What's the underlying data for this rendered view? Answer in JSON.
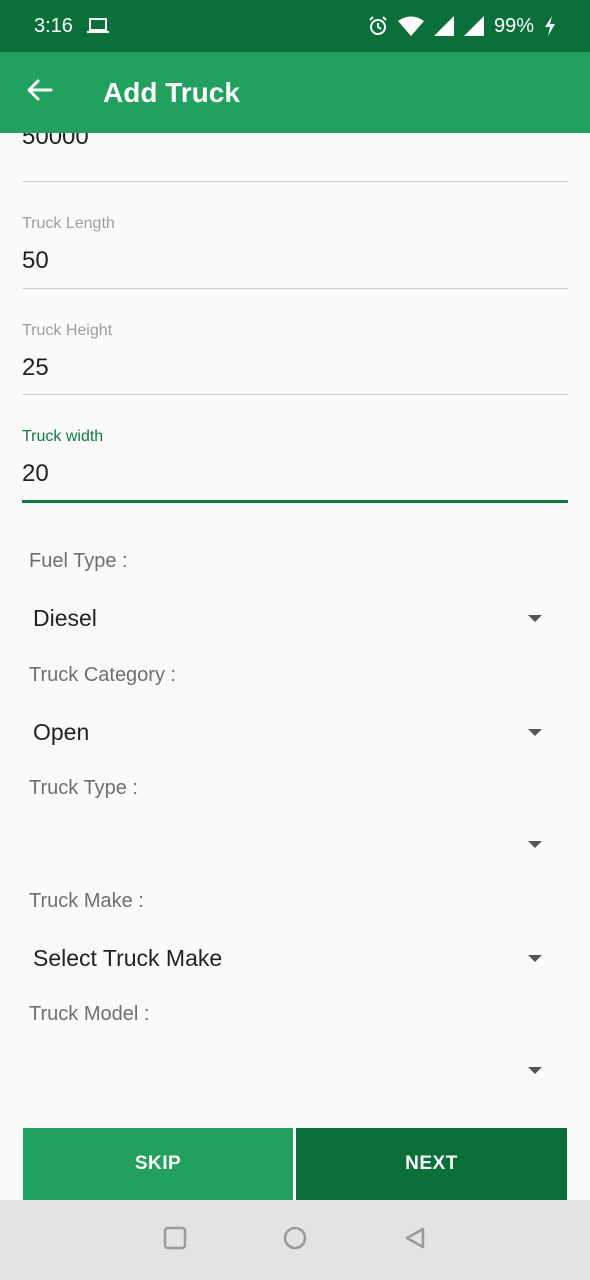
{
  "status_bar": {
    "time": "3:16",
    "battery": "99%",
    "icons": [
      "laptop-icon",
      "alarm-icon",
      "wifi-icon",
      "signal-icon",
      "signal-icon",
      "battery-charging-icon"
    ]
  },
  "app_bar": {
    "title": "Add Truck",
    "back_icon": "arrow-left-icon"
  },
  "fields": {
    "partial_value": "50000",
    "length": {
      "label": "Truck Length",
      "value": "50"
    },
    "height": {
      "label": "Truck Height",
      "value": "25"
    },
    "width": {
      "label": "Truck width",
      "value": "20"
    }
  },
  "dropdowns": {
    "fuel_type": {
      "label": "Fuel Type :",
      "value": "Diesel"
    },
    "category": {
      "label": "Truck Category :",
      "value": "Open"
    },
    "type": {
      "label": "Truck Type :",
      "value": ""
    },
    "make": {
      "label": "Truck Make :",
      "value": "Select Truck Make"
    },
    "model": {
      "label": "Truck Model :",
      "value": ""
    }
  },
  "buttons": {
    "skip": "SKIP",
    "next": "NEXT"
  },
  "colors": {
    "status_bar": "#0b6f3a",
    "app_bar": "#22a05e",
    "accent": "#0e7a3e",
    "skip_button": "#22a05e",
    "next_button": "#0b6f3a"
  },
  "nav_icons": [
    "square-icon",
    "circle-icon",
    "triangle-back-icon"
  ]
}
